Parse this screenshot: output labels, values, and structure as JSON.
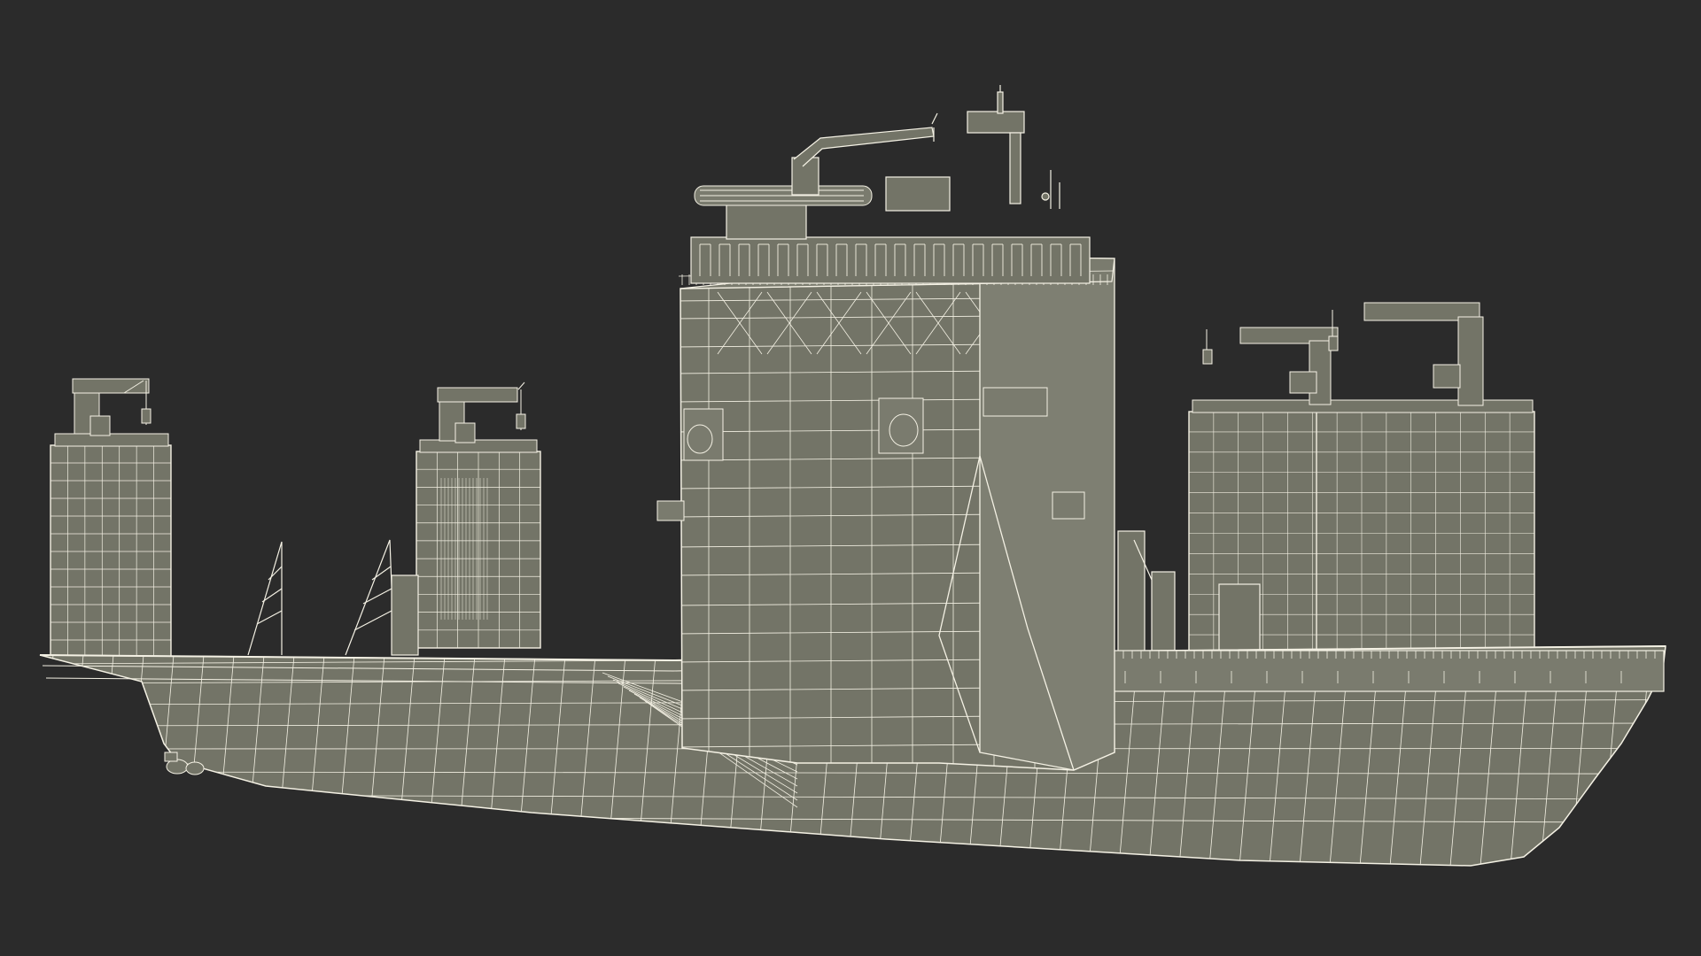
{
  "scene": {
    "subject": "semi-submersible-heavy-lift-ship-wireframe",
    "colors": {
      "background": "#2b2b2b",
      "surface": "#737467",
      "surface_dark": "#67685c",
      "surface_light": "#808174",
      "wire": "#f4f1e4",
      "wire_dim": "#d8d6c8"
    }
  }
}
